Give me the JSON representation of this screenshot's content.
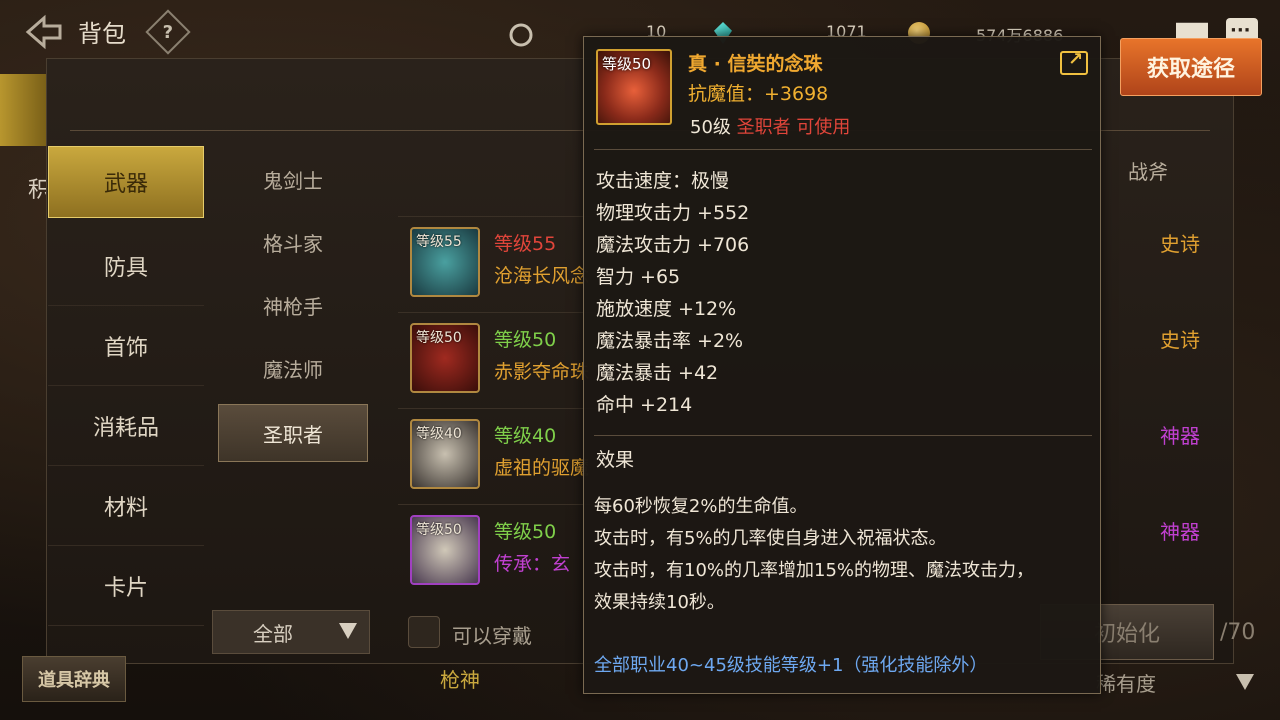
{
  "header": {
    "title": "背包",
    "help_label": "?",
    "currency_1": "10",
    "currency_2": "1071",
    "currency_3": "574万6886"
  },
  "categories": {
    "items": [
      "武器",
      "防具",
      "首饰",
      "消耗品",
      "材料",
      "卡片"
    ],
    "active_index": 0
  },
  "left_edge_label": "积",
  "classes": {
    "items": [
      "鬼剑士",
      "格斗家",
      "神枪手",
      "魔法师",
      "圣职者"
    ],
    "active_index": 4
  },
  "items": [
    {
      "thumb_level": "等级55",
      "level": "等级55",
      "name": "沧海长风念",
      "level_color": "red",
      "name_color": "orange"
    },
    {
      "thumb_level": "等级50",
      "level": "等级50",
      "name": "赤影夺命珠",
      "level_color": "green",
      "name_color": "orange"
    },
    {
      "thumb_level": "等级40",
      "level": "等级40",
      "name": "虚祖的驱魔",
      "level_color": "green",
      "name_color": "orange"
    },
    {
      "thumb_level": "等级50",
      "level": "等级50",
      "name": "传承：玄",
      "level_color": "green",
      "name_color": "purple"
    }
  ],
  "right_column": {
    "header": "战斧",
    "rarities": [
      {
        "label": "史诗",
        "color": "#e0a030"
      },
      {
        "label": "史诗",
        "color": "#e0a030"
      },
      {
        "label": "神器",
        "color": "#c040d0"
      },
      {
        "label": "神器",
        "color": "#c040d0"
      }
    ]
  },
  "bottom": {
    "filter_value": "全部",
    "checkbox_label": "可以穿戴",
    "init_label": "初始化",
    "count_label": "/70",
    "dict_label": "道具辞典",
    "gunner_label": "枪神",
    "sort_value": "稀有度"
  },
  "tooltip": {
    "thumb_level": "等级50",
    "name": "真 · 信奘的念珠",
    "resist": "抗魔值：+3698",
    "req_level": "50级",
    "req_class": "圣职者 可使用",
    "stats": [
      "攻击速度：极慢",
      "物理攻击力 +552",
      "魔法攻击力 +706",
      "智力 +65",
      "施放速度 +12%",
      "魔法暴击率 +2%",
      "魔法暴击 +42",
      "命中 +214"
    ],
    "effect_header": "效果",
    "effects": [
      "每60秒恢复2%的生命值。",
      "攻击时，有5%的几率使自身进入祝福状态。",
      "攻击时，有10%的几率增加15%的物理、魔法攻击力，",
      "效果持续10秒。"
    ],
    "bonus": "全部职业40~45级技能等级+1（强化技能除外）"
  },
  "acquire_label": "获取途径"
}
